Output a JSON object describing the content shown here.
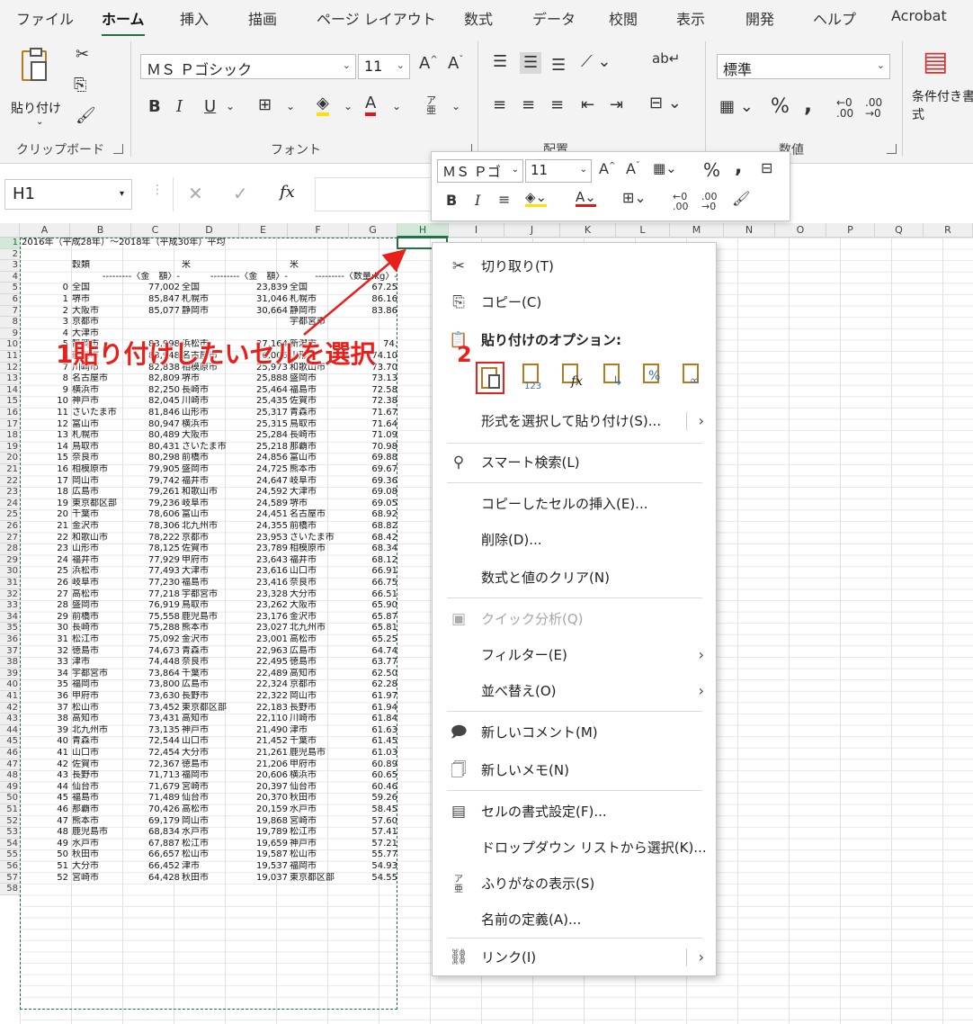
{
  "ribbon": {
    "tabs": [
      "ファイル",
      "ホーム",
      "挿入",
      "描画",
      "ページ レイアウト",
      "数式",
      "データ",
      "校閲",
      "表示",
      "開発",
      "ヘルプ",
      "Acrobat"
    ],
    "active_tab": "ホーム",
    "paste_label": "貼り付け",
    "clipboard_label": "クリップボード",
    "font_label": "フォント",
    "align_label": "配置",
    "number_label": "数値",
    "font_name": "ＭＳ Ｐゴシック",
    "font_size": "11",
    "number_format": "標準",
    "cond_format_label": "条件付き書式"
  },
  "formula_bar": {
    "name_box": "H1",
    "fx": "fx"
  },
  "mini_toolbar": {
    "font_name": "ＭＳ Ｐゴ",
    "font_size": "11"
  },
  "columns": [
    "A",
    "B",
    "C",
    "D",
    "E",
    "F",
    "G",
    "H",
    "I",
    "J",
    "K",
    "L",
    "M",
    "N",
    "O",
    "P",
    "Q",
    "R"
  ],
  "sheet": {
    "title": "2016年（平成28年）～2018年（平成30年）平均",
    "hdr_b": "穀類",
    "hdr_d": "米",
    "hdr_f": "米",
    "sub_c": "---------〈金　額〉-",
    "sub_e": "---------〈金　額〉-",
    "sub_g": "---------〈数量:kg〉-",
    "rows": [
      [
        "0",
        "全国",
        "77,002",
        "全国",
        "23,839",
        "全国",
        "67.25"
      ],
      [
        "1",
        "堺市",
        "85,847",
        "札幌市",
        "31,046",
        "札幌市",
        "86.16"
      ],
      [
        "2",
        "大阪市",
        "85,077",
        "静岡市",
        "30,664",
        "静岡市",
        "83.86"
      ],
      [
        "3",
        "京都市",
        "",
        "",
        "",
        "宇都宮市",
        ""
      ],
      [
        "4",
        "大津市",
        "",
        "",
        "",
        "",
        ""
      ],
      [
        "5",
        "静岡市",
        "83,998",
        "浜松市",
        "27,164",
        "新潟市",
        "74."
      ],
      [
        "6",
        "新潟市",
        "83,948",
        "名古屋市",
        "26,006",
        "山形市",
        "74.10"
      ],
      [
        "7",
        "川崎市",
        "82,838",
        "相模原市",
        "25,973",
        "和歌山市",
        "73.70"
      ],
      [
        "8",
        "名古屋市",
        "82,809",
        "堺市",
        "25,888",
        "盛岡市",
        "73.13"
      ],
      [
        "9",
        "横浜市",
        "82,250",
        "長崎市",
        "25,464",
        "福島市",
        "72.58"
      ],
      [
        "10",
        "神戸市",
        "82,045",
        "川崎市",
        "25,435",
        "佐賀市",
        "72.38"
      ],
      [
        "11",
        "さいたま市",
        "81,846",
        "山形市",
        "25,317",
        "青森市",
        "71.67"
      ],
      [
        "12",
        "富山市",
        "80,947",
        "横浜市",
        "25,315",
        "鳥取市",
        "71.64"
      ],
      [
        "13",
        "札幌市",
        "80,489",
        "大阪市",
        "25,284",
        "長崎市",
        "71.09"
      ],
      [
        "14",
        "鳥取市",
        "80,431",
        "さいたま市",
        "25,218",
        "那覇市",
        "70.98"
      ],
      [
        "15",
        "奈良市",
        "80,298",
        "前橋市",
        "24,856",
        "富山市",
        "69.88"
      ],
      [
        "16",
        "相模原市",
        "79,905",
        "盛岡市",
        "24,725",
        "熊本市",
        "69.67"
      ],
      [
        "17",
        "岡山市",
        "79,742",
        "福井市",
        "24,647",
        "岐阜市",
        "69.36"
      ],
      [
        "18",
        "広島市",
        "79,261",
        "和歌山市",
        "24,592",
        "大津市",
        "69.08"
      ],
      [
        "19",
        "東京都区部",
        "79,236",
        "岐阜市",
        "24,589",
        "堺市",
        "69.05"
      ],
      [
        "20",
        "千葉市",
        "78,606",
        "富山市",
        "24,451",
        "名古屋市",
        "68.92"
      ],
      [
        "21",
        "金沢市",
        "78,306",
        "北九州市",
        "24,355",
        "前橋市",
        "68.82"
      ],
      [
        "22",
        "和歌山市",
        "78,222",
        "京都市",
        "23,953",
        "さいたま市",
        "68.42"
      ],
      [
        "23",
        "山形市",
        "78,125",
        "佐賀市",
        "23,789",
        "相模原市",
        "68.34"
      ],
      [
        "24",
        "福井市",
        "77,929",
        "甲府市",
        "23,643",
        "福井市",
        "68.12"
      ],
      [
        "25",
        "浜松市",
        "77,493",
        "大津市",
        "23,616",
        "山口市",
        "66.91"
      ],
      [
        "26",
        "岐阜市",
        "77,230",
        "福島市",
        "23,416",
        "奈良市",
        "66.75"
      ],
      [
        "27",
        "高松市",
        "77,218",
        "宇都宮市",
        "23,328",
        "大分市",
        "66.51"
      ],
      [
        "28",
        "盛岡市",
        "76,919",
        "鳥取市",
        "23,262",
        "大阪市",
        "65.90"
      ],
      [
        "29",
        "前橋市",
        "75,558",
        "鹿児島市",
        "23,176",
        "金沢市",
        "65.87"
      ],
      [
        "30",
        "長崎市",
        "75,288",
        "熊本市",
        "23,027",
        "北九州市",
        "65.81"
      ],
      [
        "31",
        "松江市",
        "75,092",
        "金沢市",
        "23,001",
        "高松市",
        "65.25"
      ],
      [
        "32",
        "徳島市",
        "74,673",
        "青森市",
        "22,963",
        "広島市",
        "64.74"
      ],
      [
        "33",
        "津市",
        "74,448",
        "奈良市",
        "22,495",
        "徳島市",
        "63.77"
      ],
      [
        "34",
        "宇都宮市",
        "73,864",
        "千葉市",
        "22,489",
        "高知市",
        "62.50"
      ],
      [
        "35",
        "福岡市",
        "73,800",
        "広島市",
        "22,324",
        "京都市",
        "62.28"
      ],
      [
        "36",
        "甲府市",
        "73,630",
        "長野市",
        "22,322",
        "岡山市",
        "61.97"
      ],
      [
        "37",
        "松山市",
        "73,452",
        "東京都区部",
        "22,183",
        "長野市",
        "61.94"
      ],
      [
        "38",
        "高知市",
        "73,431",
        "高知市",
        "22,110",
        "川崎市",
        "61.84"
      ],
      [
        "39",
        "北九州市",
        "73,135",
        "神戸市",
        "21,490",
        "津市",
        "61.63"
      ],
      [
        "40",
        "青森市",
        "72,544",
        "山口市",
        "21,452",
        "千葉市",
        "61.45"
      ],
      [
        "41",
        "山口市",
        "72,454",
        "大分市",
        "21,261",
        "鹿児島市",
        "61.03"
      ],
      [
        "42",
        "佐賀市",
        "72,367",
        "徳島市",
        "21,206",
        "甲府市",
        "60.89"
      ],
      [
        "43",
        "長野市",
        "71,713",
        "福岡市",
        "20,606",
        "横浜市",
        "60.65"
      ],
      [
        "44",
        "仙台市",
        "71,679",
        "宮崎市",
        "20,397",
        "仙台市",
        "60.46"
      ],
      [
        "45",
        "福島市",
        "71,489",
        "仙台市",
        "20,370",
        "秋田市",
        "59.26"
      ],
      [
        "46",
        "那覇市",
        "70,426",
        "高松市",
        "20,159",
        "水戸市",
        "58.45"
      ],
      [
        "47",
        "熊本市",
        "69,179",
        "岡山市",
        "19,868",
        "宮崎市",
        "57.60"
      ],
      [
        "48",
        "鹿児島市",
        "68,834",
        "水戸市",
        "19,789",
        "松江市",
        "57.41"
      ],
      [
        "49",
        "水戸市",
        "67,887",
        "松江市",
        "19,659",
        "神戸市",
        "57.21"
      ],
      [
        "50",
        "秋田市",
        "66,657",
        "松山市",
        "19,587",
        "松山市",
        "55.77"
      ],
      [
        "51",
        "大分市",
        "66,452",
        "津市",
        "19,537",
        "福岡市",
        "54.93"
      ],
      [
        "52",
        "宮崎市",
        "64,428",
        "秋田市",
        "19,037",
        "東京都区部",
        "54.55"
      ]
    ]
  },
  "context_menu": {
    "cut": "切り取り(T)",
    "copy": "コピー(C)",
    "paste_options": "貼り付けのオプション:",
    "paste_special": "形式を選択して貼り付け(S)...",
    "smart_lookup": "スマート検索(L)",
    "insert_copied": "コピーしたセルの挿入(E)...",
    "delete": "削除(D)...",
    "clear": "数式と値のクリア(N)",
    "quick_analysis": "クイック分析(Q)",
    "filter": "フィルター(E)",
    "sort": "並べ替え(O)",
    "new_comment": "新しいコメント(M)",
    "new_note": "新しいメモ(N)",
    "format_cells": "セルの書式設定(F)...",
    "pick_list": "ドロップダウン リストから選択(K)...",
    "phonetic": "ふりがなの表示(S)",
    "define_name": "名前の定義(A)...",
    "link": "リンク(I)"
  },
  "annotations": {
    "step1_num": "1",
    "step1_text": "貼り付けしたいセルを選択",
    "step2_num": "2",
    "color": "#e8201c"
  }
}
